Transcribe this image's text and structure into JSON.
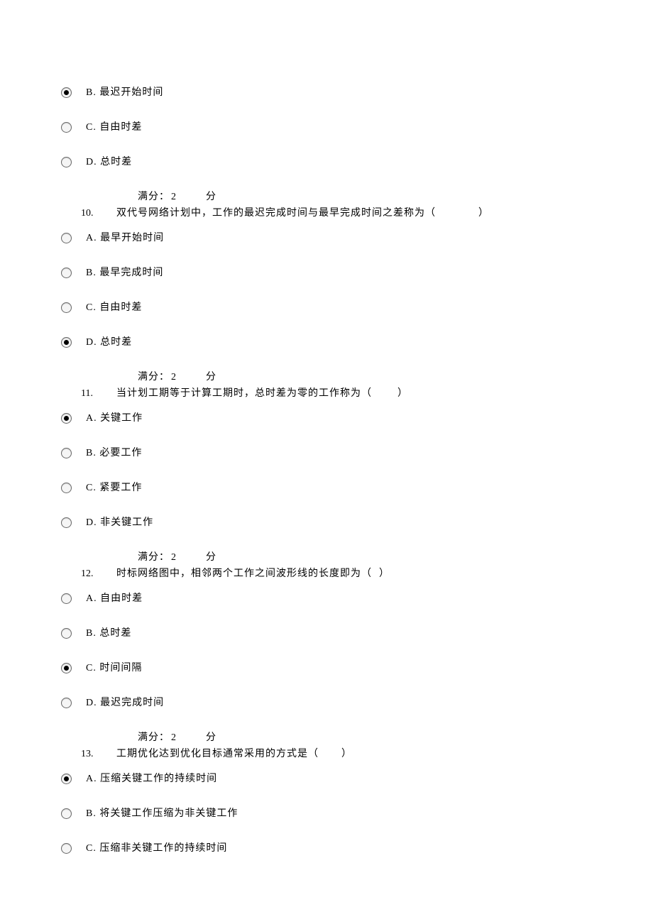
{
  "prelude": {
    "options": [
      {
        "letter": "B.",
        "text": "最迟开始时间",
        "checked": true
      },
      {
        "letter": "C.",
        "text": "自由时差",
        "checked": false
      },
      {
        "letter": "D.",
        "text": "总时差",
        "checked": false
      }
    ]
  },
  "score_label_prefix": "满分：",
  "score_value": "2",
  "score_label_suffix": "分",
  "questions": [
    {
      "number": "10.",
      "text": "双代号网络计划中，工作的最迟完成时间与最早完成时间之差称为（",
      "close": "）",
      "gap_class": "blank-1",
      "options": [
        {
          "letter": "A.",
          "text": "最早开始时间",
          "checked": false
        },
        {
          "letter": "B.",
          "text": "最早完成时间",
          "checked": false
        },
        {
          "letter": "C.",
          "text": "自由时差",
          "checked": false
        },
        {
          "letter": "D.",
          "text": "总时差",
          "checked": true
        }
      ]
    },
    {
      "number": "11.",
      "text": "当计划工期等于计算工期时，总时差为零的工作称为（",
      "close": "）",
      "gap_class": "blank-2",
      "options": [
        {
          "letter": "A.",
          "text": "关键工作",
          "checked": true
        },
        {
          "letter": "B.",
          "text": "必要工作",
          "checked": false
        },
        {
          "letter": "C.",
          "text": "紧要工作",
          "checked": false
        },
        {
          "letter": "D.",
          "text": "非关键工作",
          "checked": false
        }
      ]
    },
    {
      "number": "12.",
      "text": "时标网络图中，相邻两个工作之间波形线的长度即为（",
      "close": "）",
      "gap_class": "blank-3",
      "options": [
        {
          "letter": "A.",
          "text": "自由时差",
          "checked": false
        },
        {
          "letter": "B.",
          "text": "总时差",
          "checked": false
        },
        {
          "letter": "C.",
          "text": "时间间隔",
          "checked": true
        },
        {
          "letter": "D.",
          "text": "最迟完成时间",
          "checked": false
        }
      ]
    },
    {
      "number": "13.",
      "text": "工期优化达到优化目标通常采用的方式是（",
      "close": "）",
      "gap_class": "blank-4",
      "options": [
        {
          "letter": "A.",
          "text": "压缩关键工作的持续时间",
          "checked": true
        },
        {
          "letter": "B.",
          "text": "将关键工作压缩为非关键工作",
          "checked": false
        },
        {
          "letter": "C.",
          "text": "压缩非关键工作的持续时间",
          "checked": false
        }
      ]
    }
  ]
}
